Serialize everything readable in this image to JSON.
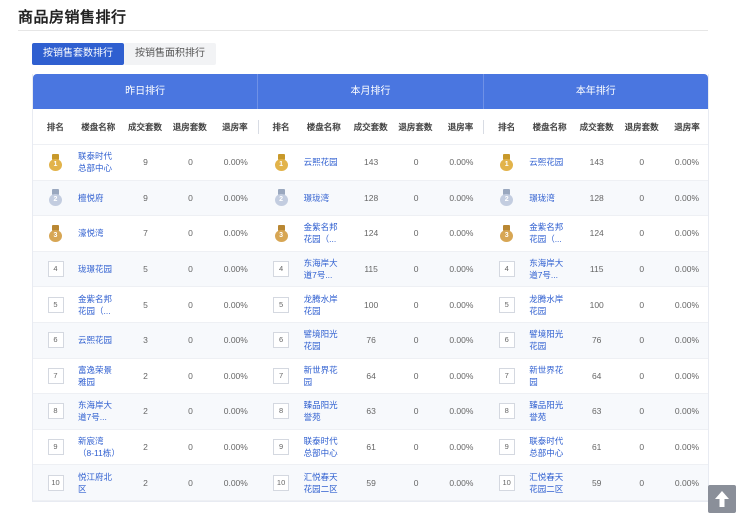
{
  "page": {
    "title": "商品房销售排行"
  },
  "tabs": [
    {
      "label": "按销售套数排行",
      "active": true
    },
    {
      "label": "按销售面积排行",
      "active": false
    }
  ],
  "groups": [
    "昨日排行",
    "本月排行",
    "本年排行"
  ],
  "columns": [
    "排名",
    "楼盘名称",
    "成交套数",
    "退房套数",
    "退房率"
  ],
  "rows": [
    {
      "rank": "1",
      "y": [
        "联泰时代总部中心",
        "9",
        "0",
        "0.00%"
      ],
      "m": [
        "云熙花园",
        "143",
        "0",
        "0.00%"
      ],
      "yr": [
        "云熙花园",
        "143",
        "0",
        "0.00%"
      ]
    },
    {
      "rank": "2",
      "y": [
        "檀悦府",
        "9",
        "0",
        "0.00%"
      ],
      "m": [
        "璟珑湾",
        "128",
        "0",
        "0.00%"
      ],
      "yr": [
        "璟珑湾",
        "128",
        "0",
        "0.00%"
      ]
    },
    {
      "rank": "3",
      "y": [
        "濠悦湾",
        "7",
        "0",
        "0.00%"
      ],
      "m": [
        "金紫名邦花园（...",
        "124",
        "0",
        "0.00%"
      ],
      "yr": [
        "金紫名邦花园（...",
        "124",
        "0",
        "0.00%"
      ]
    },
    {
      "rank": "4",
      "y": [
        "珑璟花园",
        "5",
        "0",
        "0.00%"
      ],
      "m": [
        "东海岸大道7号...",
        "115",
        "0",
        "0.00%"
      ],
      "yr": [
        "东海岸大道7号...",
        "115",
        "0",
        "0.00%"
      ]
    },
    {
      "rank": "5",
      "y": [
        "金紫名邦花园（...",
        "5",
        "0",
        "0.00%"
      ],
      "m": [
        "龙腾水岸花园",
        "100",
        "0",
        "0.00%"
      ],
      "yr": [
        "龙腾水岸花园",
        "100",
        "0",
        "0.00%"
      ]
    },
    {
      "rank": "6",
      "y": [
        "云熙花园",
        "3",
        "0",
        "0.00%"
      ],
      "m": [
        "譬境阳光花园",
        "76",
        "0",
        "0.00%"
      ],
      "yr": [
        "譬境阳光花园",
        "76",
        "0",
        "0.00%"
      ]
    },
    {
      "rank": "7",
      "y": [
        "富逸荣景雅园",
        "2",
        "0",
        "0.00%"
      ],
      "m": [
        "新世界花园",
        "64",
        "0",
        "0.00%"
      ],
      "yr": [
        "新世界花园",
        "64",
        "0",
        "0.00%"
      ]
    },
    {
      "rank": "8",
      "y": [
        "东海岸大道7号...",
        "2",
        "0",
        "0.00%"
      ],
      "m": [
        "臻品阳光誉苑",
        "63",
        "0",
        "0.00%"
      ],
      "yr": [
        "臻品阳光誉苑",
        "63",
        "0",
        "0.00%"
      ]
    },
    {
      "rank": "9",
      "y": [
        "新宸湾（8-11栋）",
        "2",
        "0",
        "0.00%"
      ],
      "m": [
        "联泰时代总部中心",
        "61",
        "0",
        "0.00%"
      ],
      "yr": [
        "联泰时代总部中心",
        "61",
        "0",
        "0.00%"
      ]
    },
    {
      "rank": "10",
      "y": [
        "悦江府北区",
        "2",
        "0",
        "0.00%"
      ],
      "m": [
        "汇悦春天花园二区",
        "59",
        "0",
        "0.00%"
      ],
      "yr": [
        "汇悦春天花园二区",
        "59",
        "0",
        "0.00%"
      ]
    }
  ],
  "colors": {
    "accent": "#2f5fd0",
    "header": "#4a76e0",
    "gold": "#e2b34a",
    "silver": "#c3cde0",
    "bronze": "#d7a654"
  },
  "icons": {
    "scroll_top": "arrow-up-icon",
    "medal": "medal-icon"
  }
}
